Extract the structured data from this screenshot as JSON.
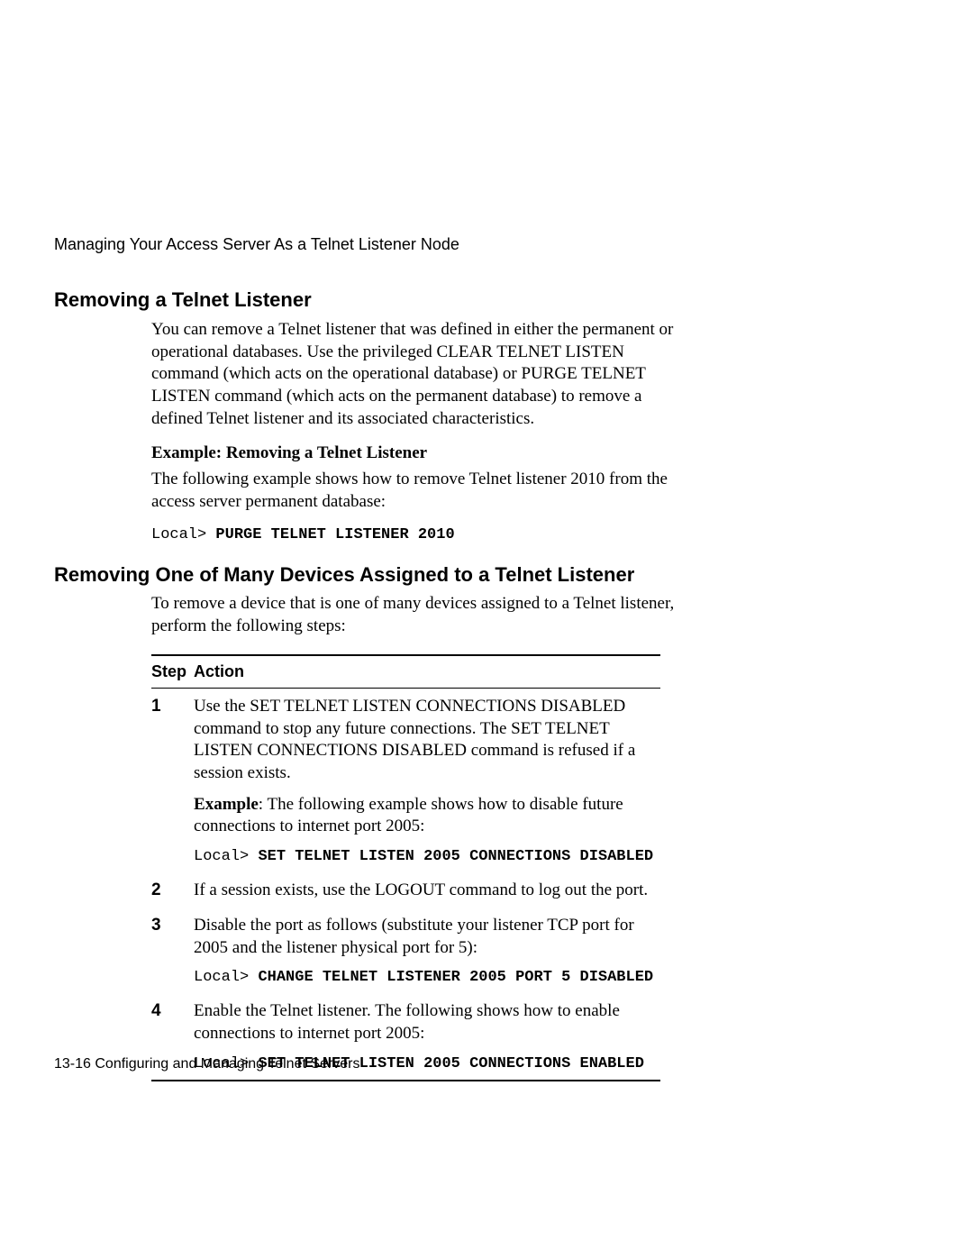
{
  "running_head": "Managing Your Access Server As a Telnet Listener Node",
  "section1": {
    "title": "Removing a Telnet Listener",
    "intro": "You can remove a Telnet listener that was defined in either the permanent or operational databases. Use the privileged CLEAR TELNET LISTEN command (which acts on the operational database) or PURGE TELNET LISTEN command (which acts on the permanent database) to remove a defined Telnet listener and its associated characteristics.",
    "example_head": "Example: Removing a Telnet Listener",
    "example_text": "The following example shows how to remove Telnet listener 2010 from the access server permanent database:",
    "prompt": "Local> ",
    "command": "PURGE TELNET LISTENER 2010"
  },
  "section2": {
    "title": "Removing One of Many Devices Assigned to a Telnet Listener",
    "intro": "To remove a device that is one of many devices assigned to a Telnet listener, perform the following steps:",
    "table": {
      "head_step": "Step",
      "head_action": "Action",
      "rows": [
        {
          "step": "1",
          "text1": "Use the SET TELNET LISTEN CONNECTIONS DISABLED command to stop any future connections. The SET TELNET LISTEN CONNECTIONS DISABLED command is refused if a session exists.",
          "example_label": "Example",
          "example_rest": ": The following example shows how to disable future connections to internet port 2005:",
          "prompt": "Local> ",
          "cmd": "SET TELNET LISTEN 2005 CONNECTIONS DISABLED"
        },
        {
          "step": "2",
          "text1": "If a session exists, use the LOGOUT command to log out the port."
        },
        {
          "step": "3",
          "text1": "Disable the port as follows (substitute your listener TCP port for 2005 and the listener physical port for 5):",
          "prompt": "Local> ",
          "cmd": "CHANGE TELNET LISTENER 2005 PORT 5 DISABLED"
        },
        {
          "step": "4",
          "text1": "Enable the Telnet listener. The following shows how to enable connections to internet port 2005:",
          "prompt": "Local> ",
          "cmd": "SET TELNET LISTEN 2005 CONNECTIONS ENABLED"
        }
      ]
    }
  },
  "footer_page": "13-16",
  "footer_text": "  Configuring and Managing Telnet Servers"
}
